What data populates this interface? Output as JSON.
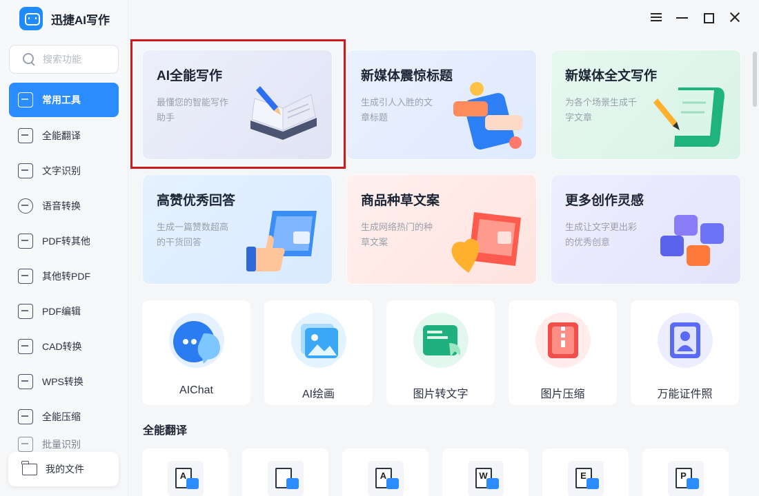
{
  "app": {
    "name": "迅捷AI写作"
  },
  "search": {
    "placeholder": "搜索功能"
  },
  "sidebar": {
    "items": [
      {
        "label": "常用工具",
        "active": true
      },
      {
        "label": "全能翻译"
      },
      {
        "label": "文字识别"
      },
      {
        "label": "语音转换"
      },
      {
        "label": "PDF转其他"
      },
      {
        "label": "其他转PDF"
      },
      {
        "label": "PDF编辑"
      },
      {
        "label": "CAD转换"
      },
      {
        "label": "WPS转换"
      },
      {
        "label": "全能压缩"
      },
      {
        "label": "批量识别"
      }
    ],
    "my_files": "我的文件"
  },
  "cards": [
    {
      "title": "AI全能写作",
      "desc": "最懂您的智能写作助手",
      "icon": "book-pen-icon"
    },
    {
      "title": "新媒体震惊标题",
      "desc": "生成引人入胜的文章标题",
      "icon": "phone-chat-icon"
    },
    {
      "title": "新媒体全文写作",
      "desc": "为各个场景生成千字文章",
      "icon": "scroll-pencil-icon"
    },
    {
      "title": "高赞优秀回答",
      "desc": "生成一篇赞数超高的干货回答",
      "icon": "thumbs-up-icon"
    },
    {
      "title": "商品种草文案",
      "desc": "生成网络热门的种草文案",
      "icon": "heart-bag-icon"
    },
    {
      "title": "更多创作灵感",
      "desc": "生成让文字更出彩的优秀创意",
      "icon": "blocks-icon"
    }
  ],
  "tools": [
    {
      "label": "AIChat",
      "icon": "chat-bubble-icon",
      "color": "#2a7cf0"
    },
    {
      "label": "AI绘画",
      "icon": "picture-icon",
      "color": "#3aa8f5"
    },
    {
      "label": "图片转文字",
      "icon": "image-to-text-icon",
      "color": "#1fb080"
    },
    {
      "label": "图片压缩",
      "icon": "zip-icon",
      "color": "#f0504a"
    },
    {
      "label": "万能证件照",
      "icon": "id-photo-icon",
      "color": "#5b6af5"
    }
  ],
  "section": {
    "title": "全能翻译"
  },
  "translate_cards": [
    {
      "letter": "A",
      "icon": "doc-translate-icon"
    },
    {
      "letter": "",
      "icon": "image-translate-icon"
    },
    {
      "letter": "A",
      "icon": "pdf-translate-icon"
    },
    {
      "letter": "W",
      "icon": "word-translate-icon"
    },
    {
      "letter": "E",
      "icon": "excel-translate-icon"
    },
    {
      "letter": "P",
      "icon": "ppt-translate-icon"
    }
  ],
  "colors": {
    "accent": "#2a8cff",
    "highlight": "#d0191c"
  }
}
